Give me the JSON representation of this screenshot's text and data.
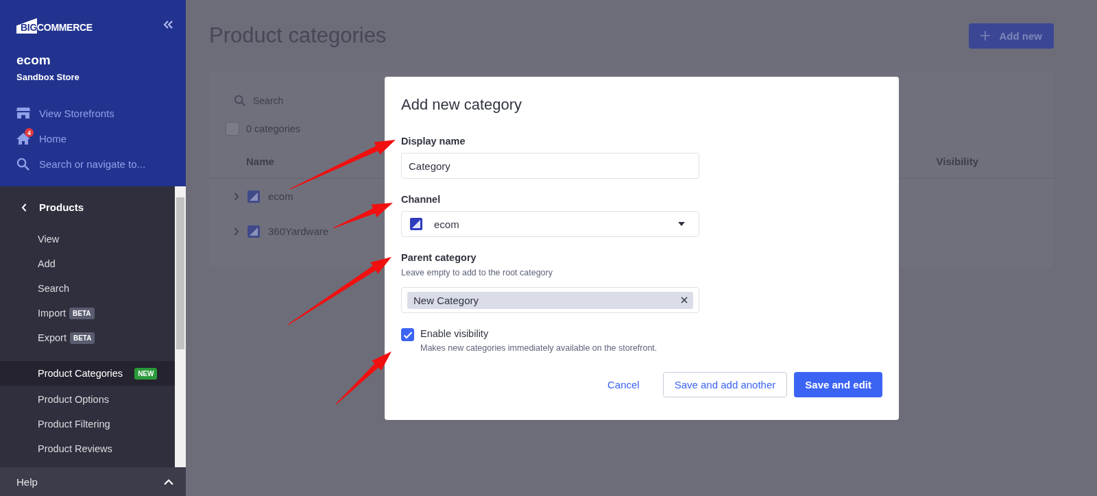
{
  "sidebar": {
    "logo": {
      "mark": "BIG",
      "word": "COMMERCE"
    },
    "store_name": "ecom",
    "store_type": "Sandbox Store",
    "links": [
      {
        "kind": "storefront",
        "label": "View Storefronts"
      },
      {
        "kind": "home",
        "label": "Home",
        "badge": "4"
      },
      {
        "kind": "search",
        "label": "Search or navigate to..."
      }
    ],
    "section": "Products",
    "groups": [
      [
        {
          "label": "View",
          "selected": false
        },
        {
          "label": "Add",
          "selected": false
        },
        {
          "label": "Search",
          "selected": false
        },
        {
          "label": "Import",
          "selected": false,
          "badge": {
            "text": "BETA",
            "kind": "beta"
          }
        },
        {
          "label": "Export",
          "selected": false,
          "badge": {
            "text": "BETA",
            "kind": "beta"
          }
        }
      ],
      [
        {
          "label": "Product Categories",
          "selected": true,
          "badge": {
            "text": "NEW",
            "kind": "new"
          }
        },
        {
          "label": "Product Options",
          "selected": false
        },
        {
          "label": "Product Filtering",
          "selected": false
        },
        {
          "label": "Product Reviews",
          "selected": false
        }
      ]
    ],
    "help": "Help"
  },
  "page": {
    "title": "Product categories",
    "add_button": "Add new",
    "search_placeholder": "Search",
    "select_all": {
      "checked": false
    },
    "count": "0 categories",
    "columns": [
      "Name",
      "Visibility"
    ],
    "rows": [
      {
        "name": "ecom",
        "expanded": false
      },
      {
        "name": "360Yardware",
        "expanded": false
      }
    ]
  },
  "modal": {
    "title": "Add new category",
    "fields": [
      {
        "kind": "text",
        "label": "Display name",
        "value": "Category"
      },
      {
        "kind": "select",
        "label": "Channel",
        "value": "ecom"
      },
      {
        "kind": "tags",
        "label": "Parent category",
        "hint": "Leave empty to add to the root category",
        "tags": [
          "New Category"
        ]
      }
    ],
    "checkbox": {
      "label": "Enable visibility",
      "description": "Makes new categories immediately available on the storefront.",
      "checked": true
    },
    "buttons": [
      {
        "kind": "link",
        "label": "Cancel"
      },
      {
        "kind": "secondary",
        "label": "Save and add another"
      },
      {
        "kind": "primary",
        "label": "Save and edit"
      }
    ]
  }
}
